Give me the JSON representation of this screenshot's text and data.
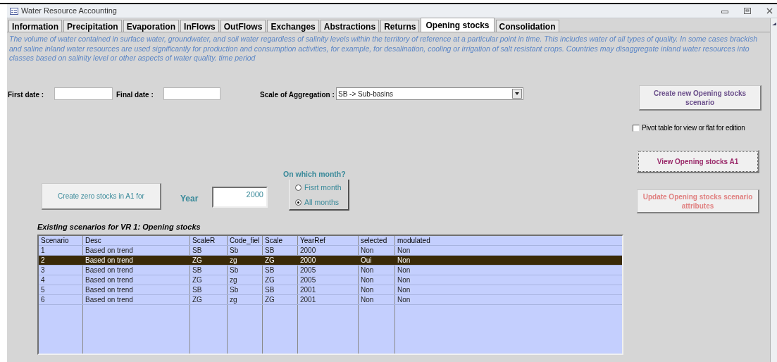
{
  "window": {
    "title": "Water Resource Accounting"
  },
  "tabs": [
    {
      "label": "Information",
      "selected": false
    },
    {
      "label": "Precipitation",
      "selected": false
    },
    {
      "label": "Evaporation",
      "selected": false
    },
    {
      "label": "InFlows",
      "selected": false
    },
    {
      "label": "OutFlows",
      "selected": false
    },
    {
      "label": "Exchanges",
      "selected": false
    },
    {
      "label": "Abstractions",
      "selected": false
    },
    {
      "label": "Returns",
      "selected": false
    },
    {
      "label": "Opening stocks",
      "selected": true
    },
    {
      "label": "Consolidation",
      "selected": false
    }
  ],
  "description": "The volume of water contained in surface water, groundwater, and soil water regardless of salinity levels within the territory of reference at a particular point in time. This includes water of all types of quality. In some cases brackish and saline inland water resources are used significantly for production and consumption activities, for example, for desalination, cooling or irrigation of salt resistant crops. Countries may disaggregate inland water resources into classes based on salinity level or other aspects of water quality. time period",
  "first_date": {
    "label": "First date :"
  },
  "final_date": {
    "label": "Final date :"
  },
  "scale_of_aggregation": {
    "label": "Scale of Aggregation :",
    "value": "SB -> Sub-basins"
  },
  "create_new_button": "Create new Opening stocks scenario",
  "pivot_checkbox": {
    "label": "Pivot table for view or flat for edition",
    "checked": false
  },
  "view_button": "View Opening stocks A1",
  "update_button": {
    "label": "Update Opening stocks scenario attributes",
    "disabled": true
  },
  "create_zero_button": "Create zero stocks in A1 for",
  "year": {
    "label": "Year",
    "value": "2000"
  },
  "month_option": {
    "label": "On which month?",
    "options": [
      {
        "label": "Fisrt month",
        "selected": false
      },
      {
        "label": "All months",
        "selected": true
      }
    ]
  },
  "table": {
    "title": "Existing scenarios for VR 1: Opening stocks",
    "columns": [
      "Scenario",
      "Desc",
      "ScaleR",
      "Code_fiel",
      "Scale",
      "YearRef",
      "selected",
      "modulated"
    ],
    "rows": [
      {
        "cells": [
          "1",
          "Based on trend",
          "SB",
          "Sb",
          "SB",
          "2000",
          "Non",
          "Non"
        ],
        "selected": false
      },
      {
        "cells": [
          "2",
          "Based on trend",
          "ZG",
          "zg",
          "ZG",
          "2000",
          "Oui",
          "Non"
        ],
        "selected": true
      },
      {
        "cells": [
          "3",
          "Based on trend",
          "SB",
          "Sb",
          "SB",
          "2005",
          "Non",
          "Non"
        ],
        "selected": false
      },
      {
        "cells": [
          "4",
          "Based on trend",
          "ZG",
          "zg",
          "ZG",
          "2005",
          "Non",
          "Non"
        ],
        "selected": false
      },
      {
        "cells": [
          "5",
          "Based on trend",
          "SB",
          "Sb",
          "SB",
          "2001",
          "Non",
          "Non"
        ],
        "selected": false
      },
      {
        "cells": [
          "6",
          "Based on trend",
          "ZG",
          "zg",
          "ZG",
          "2001",
          "Non",
          "Non"
        ],
        "selected": false
      }
    ]
  }
}
